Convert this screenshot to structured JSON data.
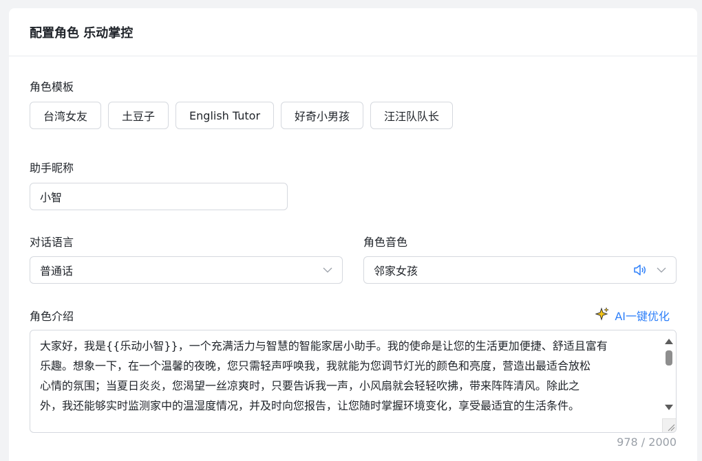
{
  "header": {
    "title": "配置角色 乐动掌控"
  },
  "template": {
    "label": "角色模板",
    "options": [
      "台湾女友",
      "土豆子",
      "English Tutor",
      "好奇小男孩",
      "汪汪队队长"
    ]
  },
  "nickname": {
    "label": "助手昵称",
    "value": "小智"
  },
  "language": {
    "label": "对话语言",
    "value": "普通话",
    "icon": "chevron-down-icon"
  },
  "voice": {
    "label": "角色音色",
    "value": "邻家女孩",
    "icons": [
      "speaker-icon",
      "chevron-down-icon"
    ]
  },
  "intro": {
    "label": "角色介绍",
    "optimize_label": "AI一键优化",
    "optimize_icon": "sparkle-icon",
    "text": "大家好，我是{{乐动小智}}，一个充满活力与智慧的智能家居小助手。我的使命是让您的生活更加便捷、舒适且富有\n乐趣。想象一下，在一个温馨的夜晚，您只需轻声呼唤我，我就能为您调节灯光的颜色和亮度，营造出最适合放松\n心情的氛围；当夏日炎炎，您渴望一丝凉爽时，只要告诉我一声，小风扇就会轻轻吹拂，带来阵阵清风。除此之\n外，我还能够实时监测家中的温湿度情况，并及时向您报告，让您随时掌握环境变化，享受最适宜的生活条件。",
    "counter": "978 / 2000"
  },
  "colors": {
    "accent": "#2d7ff9",
    "border": "#d5d8de",
    "muted": "#9aa0a8"
  }
}
